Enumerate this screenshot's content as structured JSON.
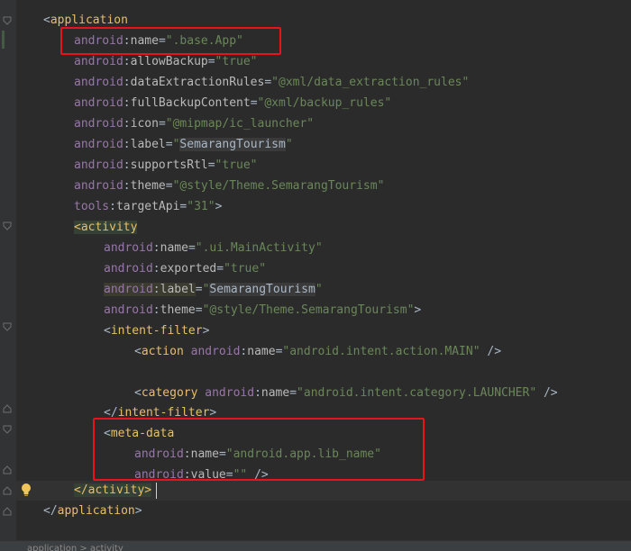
{
  "lines": {
    "application_open": {
      "lt": "<",
      "tag": "application"
    },
    "name": {
      "ns": "android",
      "attr": "name",
      "eq": "=",
      "val": "\".base.App\""
    },
    "allowBackup": {
      "ns": "android",
      "attr": "allowBackup",
      "eq": "=",
      "val": "\"true\""
    },
    "dataExtractionRules": {
      "ns": "android",
      "attr": "dataExtractionRules",
      "eq": "=",
      "val": "\"@xml/data_extraction_rules\""
    },
    "fullBackupContent": {
      "ns": "android",
      "attr": "fullBackupContent",
      "eq": "=",
      "val": "\"@xml/backup_rules\""
    },
    "icon": {
      "ns": "android",
      "attr": "icon",
      "eq": "=",
      "val": "\"@mipmap/ic_launcher\""
    },
    "label": {
      "ns": "android",
      "attr": "label",
      "eq": "=",
      "q1": "\"",
      "val": "SemarangTourism",
      "q2": "\""
    },
    "supportsRtl": {
      "ns": "android",
      "attr": "supportsRtl",
      "eq": "=",
      "val": "\"true\""
    },
    "theme": {
      "ns": "android",
      "attr": "theme",
      "eq": "=",
      "val": "\"@style/Theme.SemarangTourism\""
    },
    "targetApi": {
      "ns": "tools",
      "attr": "targetApi",
      "eq": "=",
      "val": "\"31\"",
      "close": ">"
    },
    "activity_open": {
      "lt": "<",
      "tag": "activity"
    },
    "act_name": {
      "ns": "android",
      "attr": "name",
      "eq": "=",
      "val": "\".ui.MainActivity\""
    },
    "act_exported": {
      "ns": "android",
      "attr": "exported",
      "eq": "=",
      "val": "\"true\""
    },
    "act_label": {
      "ns": "android",
      "attr": "label",
      "eq": "=",
      "q1": "\"",
      "val": "SemarangTourism",
      "q2": "\""
    },
    "act_theme": {
      "ns": "android",
      "attr": "theme",
      "eq": "=",
      "val": "\"@style/Theme.SemarangTourism\"",
      "close": ">"
    },
    "intent_filter_open": {
      "lt": "<",
      "tag": "intent-filter",
      "gt": ">"
    },
    "action": {
      "lt": "<",
      "tag": "action",
      "ns": "android",
      "attr": "name",
      "eq": "=",
      "val": "\"android.intent.action.MAIN\"",
      "close": "/>"
    },
    "category": {
      "lt": "<",
      "tag": "category",
      "ns": "android",
      "attr": "name",
      "eq": "=",
      "val": "\"android.intent.category.LAUNCHER\"",
      "close": "/>"
    },
    "intent_filter_close": {
      "lt": "</",
      "tag": "intent-filter",
      "gt": ">"
    },
    "meta_data_open": {
      "lt": "<",
      "tag": "meta-data"
    },
    "meta_name": {
      "ns": "android",
      "attr": "name",
      "eq": "=",
      "val": "\"android.app.lib_name\""
    },
    "meta_value": {
      "ns": "android",
      "attr": "value",
      "eq": "=",
      "val": "\"\"",
      "close": "/>"
    },
    "activity_close": {
      "lt": "</",
      "tag": "activity",
      "gt": ">"
    },
    "application_close": {
      "lt": "</",
      "tag": "application",
      "gt": ">"
    }
  },
  "colors": {
    "background": "#2b2b2b",
    "tag": "#e8bf6a",
    "namespace": "#9876aa",
    "attribute": "#bababa",
    "value": "#6a8759",
    "highlight_box": "#e8131b"
  },
  "status_bar": {
    "text": "application > activity"
  }
}
